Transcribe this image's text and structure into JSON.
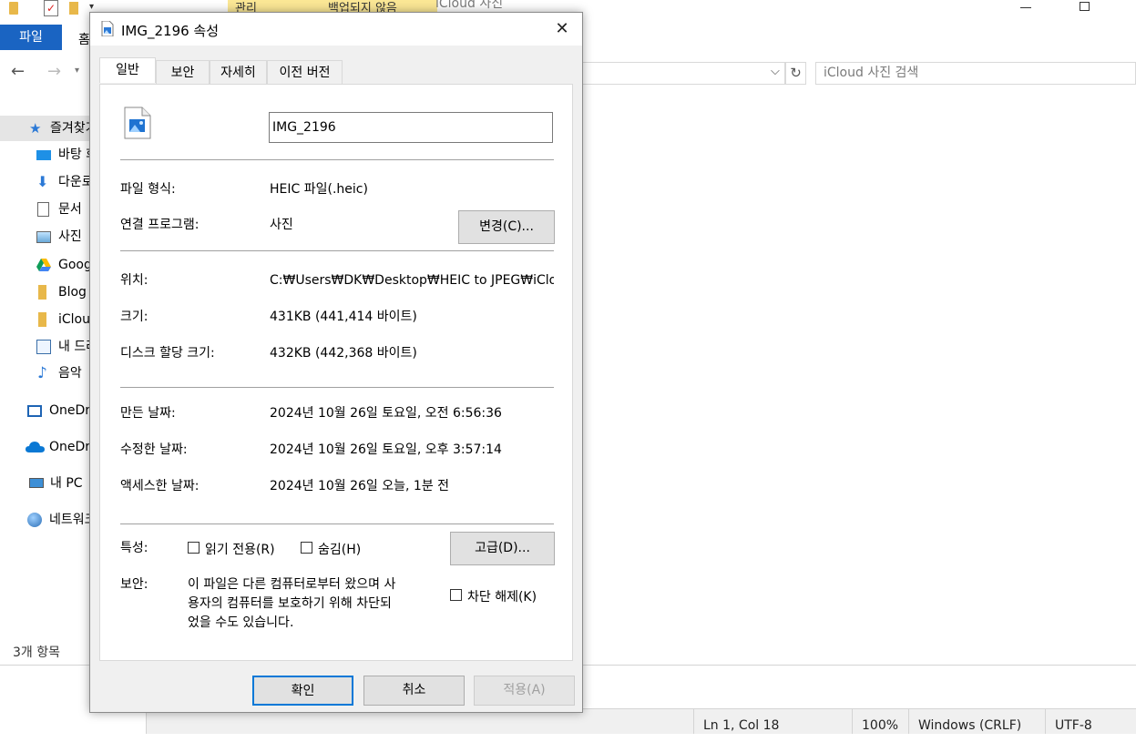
{
  "explorer": {
    "ribbon": {
      "manage_tab": "관리",
      "unsynced_tab": "백업되지 않음",
      "window_title": "iCloud 사진",
      "file_tab": "파일",
      "home_tab": "홈"
    },
    "search_placeholder": "iCloud 사진 검색",
    "sidebar": {
      "items": [
        {
          "label": "즐겨찾기",
          "icon": "star-icon"
        },
        {
          "label": "바탕 화면",
          "icon": "desktop-icon"
        },
        {
          "label": "다운로드",
          "icon": "download-icon"
        },
        {
          "label": "문서",
          "icon": "document-icon"
        },
        {
          "label": "사진",
          "icon": "pictures-icon"
        },
        {
          "label": "Google Drive",
          "icon": "google-drive-icon"
        },
        {
          "label": "Blog",
          "icon": "folder-icon"
        },
        {
          "label": "iCloud 사진",
          "icon": "folder-icon"
        },
        {
          "label": "내 드라이브",
          "icon": "my-drive-icon"
        },
        {
          "label": "음악",
          "icon": "music-icon"
        },
        {
          "label": "OneDrive",
          "icon": "onedrive-personal-icon"
        },
        {
          "label": "OneDrive",
          "icon": "onedrive-cloud-icon"
        },
        {
          "label": "내 PC",
          "icon": "pc-icon"
        },
        {
          "label": "네트워크",
          "icon": "network-icon"
        }
      ]
    },
    "item_count": "3개 항목"
  },
  "notepad_status": {
    "position": "Ln 1, Col 18",
    "zoom": "100%",
    "line_ending": "Windows (CRLF)",
    "encoding": "UTF-8"
  },
  "dialog": {
    "title": "IMG_2196 속성",
    "close_glyph": "✕",
    "tabs": [
      "일반",
      "보안",
      "자세히",
      "이전 버전"
    ],
    "file_name": "IMG_2196",
    "rows": {
      "file_type_label": "파일 형식:",
      "file_type_value": "HEIC 파일(.heic)",
      "opens_with_label": "연결 프로그램:",
      "opens_with_value": "사진",
      "change_button": "변경(C)...",
      "location_label": "위치:",
      "location_value": "C:₩Users₩DK₩Desktop₩HEIC to JPEG₩iCloud 사진",
      "size_label": "크기:",
      "size_value": "431KB (441,414 바이트)",
      "size_on_disk_label": "디스크 할당 크기:",
      "size_on_disk_value": "432KB (442,368 바이트)",
      "created_label": "만든 날짜:",
      "created_value": "2024년 10월 26일 토요일, 오전 6:56:36",
      "modified_label": "수정한 날짜:",
      "modified_value": "2024년 10월 26일 토요일, 오후 3:57:14",
      "accessed_label": "액세스한 날짜:",
      "accessed_value": "2024년 10월 26일 오늘, 1분 전",
      "attributes_label": "특성:",
      "readonly_label": "읽기 전용(R)",
      "hidden_label": "숨김(H)",
      "advanced_button": "고급(D)...",
      "security_label": "보안:",
      "security_line1": "이 파일은 다른 컴퓨터로부터 왔으며 사",
      "security_line2": "용자의 컴퓨터를 보호하기 위해 차단되",
      "security_line3": "었을 수도 있습니다.",
      "unblock_label": "차단 해제(K)"
    },
    "footer": {
      "ok": "확인",
      "cancel": "취소",
      "apply": "적용(A)"
    }
  }
}
